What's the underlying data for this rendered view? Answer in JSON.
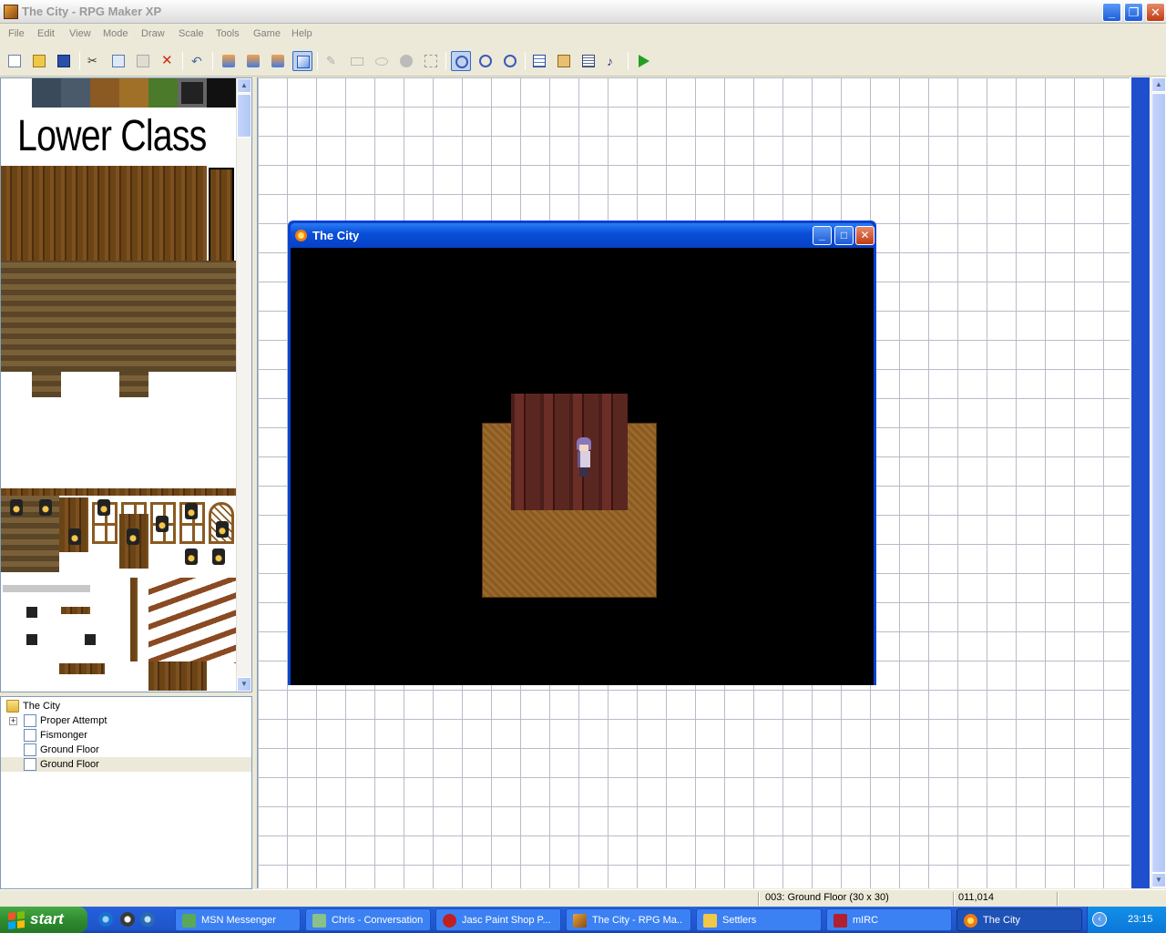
{
  "window": {
    "title": "The City - RPG Maker XP"
  },
  "menu": [
    "File",
    "Edit",
    "View",
    "Mode",
    "Draw",
    "Scale",
    "Tools",
    "Game",
    "Help"
  ],
  "toolbar": {
    "buttons": [
      "new-icon",
      "open-icon",
      "save-icon",
      "cut-icon",
      "copy-icon",
      "paste-icon",
      "delete-icon",
      "undo-icon",
      "layer1-icon",
      "layer2-icon",
      "layer3-icon",
      "events-icon",
      "pencil-icon",
      "rectangle-icon",
      "ellipse-icon",
      "fill-icon",
      "select-icon",
      "zoom-1x-icon",
      "zoom-2x-icon",
      "zoom-4x-icon",
      "database-icon",
      "materialbase-icon",
      "script-editor-icon",
      "sound-test-icon",
      "playtest-icon"
    ]
  },
  "tileset": {
    "title": "Lower Class"
  },
  "maptree": {
    "root": "The City",
    "items": [
      "Proper Attempt",
      "Fismonger",
      "Ground Floor",
      "Ground Floor"
    ]
  },
  "gamewindow": {
    "title": "The City"
  },
  "statusbar": {
    "map": "003: Ground Floor (30 x 30)",
    "coords": "011,014"
  },
  "taskbar": {
    "start": "start",
    "tasks": [
      "MSN Messenger",
      "Chris - Conversation",
      "Jasc Paint Shop P...",
      "The City - RPG Ma...",
      "Settlers",
      "mIRC",
      "The City"
    ],
    "clock": "23:15"
  },
  "colors": {
    "accent": "#0842d0",
    "taskbar": "#245edb",
    "start": "#2f8c2f"
  }
}
